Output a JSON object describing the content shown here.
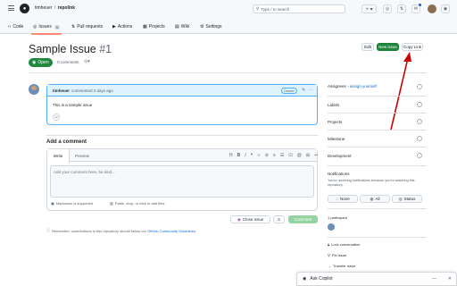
{
  "header": {
    "owner": "timheuer",
    "separator": "/",
    "repo": "repolink",
    "search_placeholder": "Type / to search",
    "search_hint": "/"
  },
  "nav": [
    {
      "label": "Code",
      "count": ""
    },
    {
      "label": "Issues",
      "count": "1"
    },
    {
      "label": "Pull requests",
      "count": ""
    },
    {
      "label": "Actions",
      "count": ""
    },
    {
      "label": "Projects",
      "count": ""
    },
    {
      "label": "Wiki",
      "count": ""
    },
    {
      "label": "Settings",
      "count": ""
    }
  ],
  "issue": {
    "title": "Sample Issue",
    "number": "#1",
    "state": "Open",
    "comments": "0 comments",
    "edit_label": "Edit",
    "new_issue_label": "New issue",
    "copy_link_label": "Copy Link"
  },
  "comment": {
    "author": "timheuer",
    "meta": "commented 2 days ago",
    "role": "Owner",
    "body": "This is a sample issue"
  },
  "add_comment": {
    "heading": "Add a comment",
    "tab_write": "Write",
    "tab_preview": "Preview",
    "placeholder": "Add your comment here, be kind...",
    "markdown_note": "Markdown is supported",
    "attach_note": "Paste, drop, or click to add files",
    "close_issue": "Close issue",
    "submit": "Comment",
    "remember_prefix": "Remember, contributions to this repository should follow our ",
    "remember_link": "GitHub Community Guidelines",
    "remember_suffix": "."
  },
  "sidebar": {
    "assignees_label": "Assignees",
    "assign_yourself": "assign yourself",
    "labels": "Labels",
    "projects": "Projects",
    "milestone": "Milestone",
    "development": "Development",
    "notifications": "Notifications",
    "notif_text": "You're receiving notifications because you're watching this repository.",
    "notif_buttons": [
      "None",
      "All",
      "Status"
    ],
    "participants": "1 participant",
    "lock": "Lock conversation",
    "pin": "Pin issue",
    "transfer": "Transfer issue"
  },
  "copilot": {
    "label": "Ask Copilot"
  },
  "colors": {
    "green": "#1f883d",
    "arrow": "#cc0000",
    "accent": "#0969da"
  }
}
